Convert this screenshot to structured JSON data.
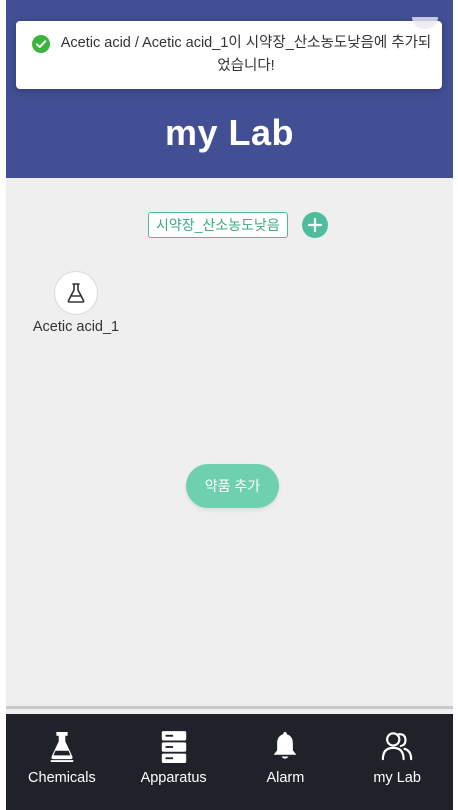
{
  "header": {
    "title": "my Lab"
  },
  "toast": {
    "message": "Acetic acid / Acetic acid_1이 시약장_산소농도낮음에 추가되었습니다!",
    "icon": "check-circle-icon",
    "icon_color": "#3cb43c"
  },
  "group": {
    "name": "시약장_산소농도낮음",
    "add_icon": "plus-icon"
  },
  "items": [
    {
      "name": "Acetic acid_1",
      "icon": "flask-icon"
    }
  ],
  "add_button": {
    "label": "약품 추가"
  },
  "tabs": [
    {
      "label": "Chemicals",
      "icon": "flask-icon"
    },
    {
      "label": "Apparatus",
      "icon": "server-icon"
    },
    {
      "label": "Alarm",
      "icon": "bell-icon"
    },
    {
      "label": "my Lab",
      "icon": "users-icon"
    }
  ],
  "colors": {
    "header_bg": "#424f94",
    "accent_green": "#4dbd9b",
    "button_green": "#6fd0af",
    "tabbar_bg": "#1f2228",
    "content_bg": "#efefef"
  }
}
